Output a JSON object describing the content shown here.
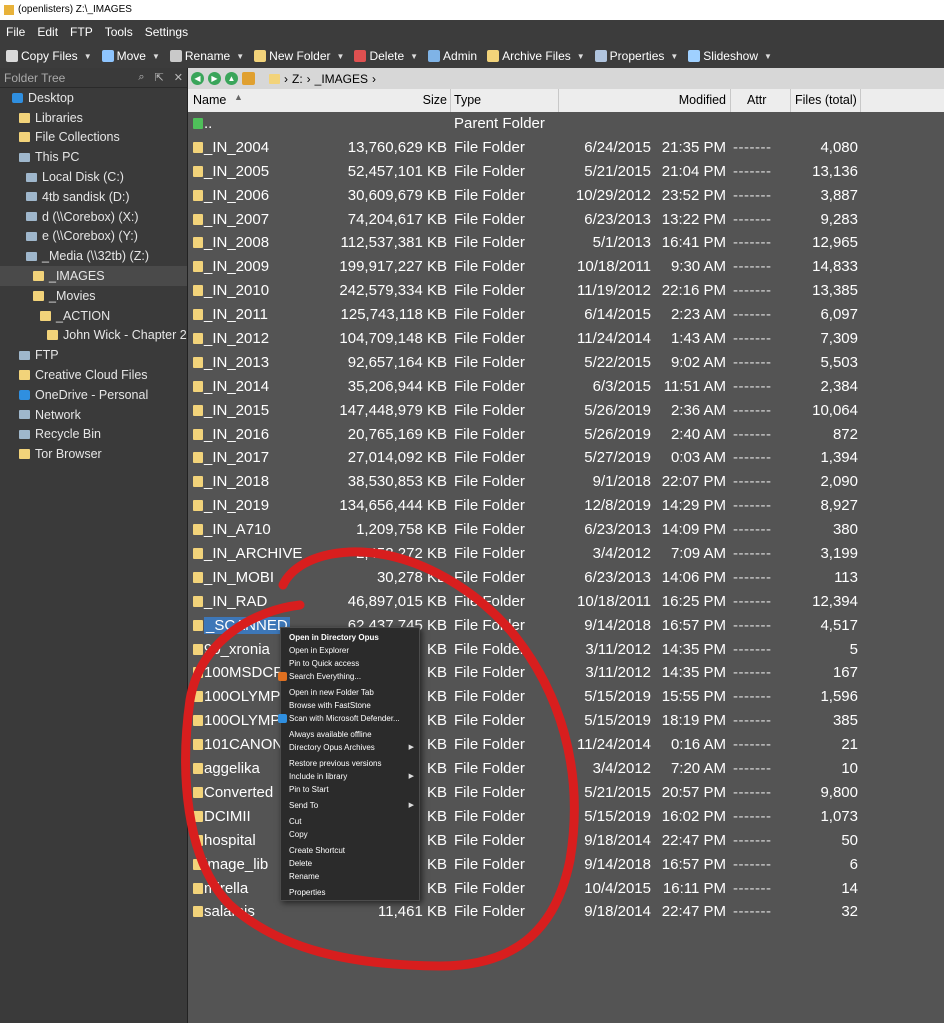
{
  "window": {
    "title": "(openlisters) Z:\\_IMAGES"
  },
  "menu": [
    "File",
    "Edit",
    "FTP",
    "Tools",
    "Settings"
  ],
  "toolbar": [
    {
      "label": "Copy Files",
      "dropdown": true,
      "icon": "copy-icon",
      "color": "#d9d9d9"
    },
    {
      "label": "Move",
      "dropdown": true,
      "icon": "move-icon",
      "color": "#8ec5ff"
    },
    {
      "label": "Rename",
      "dropdown": true,
      "icon": "rename-icon",
      "color": "#c9c9c9"
    },
    {
      "label": "New Folder",
      "dropdown": true,
      "icon": "new-folder-icon",
      "color": "#f2d37a"
    },
    {
      "label": "Delete",
      "dropdown": true,
      "icon": "delete-icon",
      "color": "#e05050"
    },
    {
      "label": "Admin",
      "dropdown": false,
      "icon": "admin-icon",
      "color": "#7fb3e6"
    },
    {
      "label": "Archive Files",
      "dropdown": true,
      "icon": "archive-icon",
      "color": "#f2d37a"
    },
    {
      "label": "Properties",
      "dropdown": true,
      "icon": "properties-icon",
      "color": "#b0c4de"
    },
    {
      "label": "Slideshow",
      "dropdown": true,
      "icon": "slideshow-icon",
      "color": "#9fd0ff"
    }
  ],
  "folder_tree": {
    "title": "Folder Tree",
    "items": [
      {
        "label": "Desktop",
        "indent": 0,
        "icon": "desktop-icon"
      },
      {
        "label": "Libraries",
        "indent": 1,
        "icon": "libraries-icon"
      },
      {
        "label": "File Collections",
        "indent": 1,
        "icon": "collections-icon"
      },
      {
        "label": "This PC",
        "indent": 1,
        "icon": "pc-icon"
      },
      {
        "label": "Local Disk (C:)",
        "indent": 2,
        "icon": "drive-icon"
      },
      {
        "label": "4tb sandisk (D:)",
        "indent": 2,
        "icon": "drive-icon"
      },
      {
        "label": "d (\\\\Corebox) (X:)",
        "indent": 2,
        "icon": "network-drive-icon"
      },
      {
        "label": "e (\\\\Corebox) (Y:)",
        "indent": 2,
        "icon": "network-drive-icon"
      },
      {
        "label": "_Media (\\\\32tb) (Z:)",
        "indent": 2,
        "icon": "network-drive-icon"
      },
      {
        "label": "_IMAGES",
        "indent": 3,
        "icon": "folder-icon",
        "selected": true
      },
      {
        "label": "_Movies",
        "indent": 3,
        "icon": "folder-icon"
      },
      {
        "label": "_ACTION",
        "indent": 4,
        "icon": "folder-icon"
      },
      {
        "label": "John Wick - Chapter 2",
        "indent": 5,
        "icon": "folder-icon"
      },
      {
        "label": "FTP",
        "indent": 1,
        "icon": "ftp-icon"
      },
      {
        "label": "Creative Cloud Files",
        "indent": 1,
        "icon": "cloud-icon"
      },
      {
        "label": "OneDrive - Personal",
        "indent": 1,
        "icon": "onedrive-icon"
      },
      {
        "label": "Network",
        "indent": 1,
        "icon": "network-icon"
      },
      {
        "label": "Recycle Bin",
        "indent": 1,
        "icon": "recycle-bin-icon"
      },
      {
        "label": "Tor Browser",
        "indent": 1,
        "icon": "folder-icon"
      }
    ]
  },
  "path": {
    "drive": "Z:",
    "folder": "_IMAGES",
    "sep": "›"
  },
  "columns": {
    "name": "Name",
    "size": "Size",
    "type": "Type",
    "modified": "Modified",
    "attr": "Attr",
    "files": "Files (total)"
  },
  "parent_row": {
    "name": "..",
    "type": "Parent Folder"
  },
  "files": [
    {
      "name": "_IN_2004",
      "size": "13,760,629 KB",
      "type": "File Folder",
      "date": "6/24/2015",
      "time": "21:35 PM",
      "attr": "-------",
      "files": "4,080"
    },
    {
      "name": "_IN_2005",
      "size": "52,457,101 KB",
      "type": "File Folder",
      "date": "5/21/2015",
      "time": "21:04 PM",
      "attr": "-------",
      "files": "13,136"
    },
    {
      "name": "_IN_2006",
      "size": "30,609,679 KB",
      "type": "File Folder",
      "date": "10/29/2012",
      "time": "23:52 PM",
      "attr": "-------",
      "files": "3,887"
    },
    {
      "name": "_IN_2007",
      "size": "74,204,617 KB",
      "type": "File Folder",
      "date": "6/23/2013",
      "time": "13:22 PM",
      "attr": "-------",
      "files": "9,283"
    },
    {
      "name": "_IN_2008",
      "size": "112,537,381 KB",
      "type": "File Folder",
      "date": "5/1/2013",
      "time": "16:41 PM",
      "attr": "-------",
      "files": "12,965"
    },
    {
      "name": "_IN_2009",
      "size": "199,917,227 KB",
      "type": "File Folder",
      "date": "10/18/2011",
      "time": "9:30 AM",
      "attr": "-------",
      "files": "14,833"
    },
    {
      "name": "_IN_2010",
      "size": "242,579,334 KB",
      "type": "File Folder",
      "date": "11/19/2012",
      "time": "22:16 PM",
      "attr": "-------",
      "files": "13,385"
    },
    {
      "name": "_IN_2011",
      "size": "125,743,118 KB",
      "type": "File Folder",
      "date": "6/14/2015",
      "time": "2:23 AM",
      "attr": "-------",
      "files": "6,097"
    },
    {
      "name": "_IN_2012",
      "size": "104,709,148 KB",
      "type": "File Folder",
      "date": "11/24/2014",
      "time": "1:43 AM",
      "attr": "-------",
      "files": "7,309"
    },
    {
      "name": "_IN_2013",
      "size": "92,657,164 KB",
      "type": "File Folder",
      "date": "5/22/2015",
      "time": "9:02 AM",
      "attr": "-------",
      "files": "5,503"
    },
    {
      "name": "_IN_2014",
      "size": "35,206,944 KB",
      "type": "File Folder",
      "date": "6/3/2015",
      "time": "11:51 AM",
      "attr": "-------",
      "files": "2,384"
    },
    {
      "name": "_IN_2015",
      "size": "147,448,979 KB",
      "type": "File Folder",
      "date": "5/26/2019",
      "time": "2:36 AM",
      "attr": "-------",
      "files": "10,064"
    },
    {
      "name": "_IN_2016",
      "size": "20,765,169 KB",
      "type": "File Folder",
      "date": "5/26/2019",
      "time": "2:40 AM",
      "attr": "-------",
      "files": "872"
    },
    {
      "name": "_IN_2017",
      "size": "27,014,092 KB",
      "type": "File Folder",
      "date": "5/27/2019",
      "time": "0:03 AM",
      "attr": "-------",
      "files": "1,394"
    },
    {
      "name": "_IN_2018",
      "size": "38,530,853 KB",
      "type": "File Folder",
      "date": "9/1/2018",
      "time": "22:07 PM",
      "attr": "-------",
      "files": "2,090"
    },
    {
      "name": "_IN_2019",
      "size": "134,656,444 KB",
      "type": "File Folder",
      "date": "12/8/2019",
      "time": "14:29 PM",
      "attr": "-------",
      "files": "8,927"
    },
    {
      "name": "_IN_A710",
      "size": "1,209,758 KB",
      "type": "File Folder",
      "date": "6/23/2013",
      "time": "14:09 PM",
      "attr": "-------",
      "files": "380"
    },
    {
      "name": "_IN_ARCHIVE",
      "size": "2,458,272 KB",
      "type": "File Folder",
      "date": "3/4/2012",
      "time": "7:09 AM",
      "attr": "-------",
      "files": "3,199"
    },
    {
      "name": "_IN_MOBI",
      "size": "30,278 KB",
      "type": "File Folder",
      "date": "6/23/2013",
      "time": "14:06 PM",
      "attr": "-------",
      "files": "113"
    },
    {
      "name": "_IN_RAD",
      "size": "46,897,015 KB",
      "type": "File Folder",
      "date": "10/18/2011",
      "time": "16:25 PM",
      "attr": "-------",
      "files": "12,394"
    },
    {
      "name": "_SCANNED",
      "size": "62,437,745 KB",
      "type": "File Folder",
      "date": "9/14/2018",
      "time": "16:57 PM",
      "attr": "-------",
      "files": "4,517",
      "highlighted": true
    },
    {
      "name": "90_xronia",
      "size": "KB",
      "type": "File Folder",
      "date": "3/11/2012",
      "time": "14:35 PM",
      "attr": "-------",
      "files": "5"
    },
    {
      "name": "100MSDCF",
      "size": "KB",
      "type": "File Folder",
      "date": "3/11/2012",
      "time": "14:35 PM",
      "attr": "-------",
      "files": "167"
    },
    {
      "name": "100OLYMP",
      "size": "KB",
      "type": "File Folder",
      "date": "5/15/2019",
      "time": "15:55 PM",
      "attr": "-------",
      "files": "1,596"
    },
    {
      "name": "100OLYMP",
      "size": "KB",
      "type": "File Folder",
      "date": "5/15/2019",
      "time": "18:19 PM",
      "attr": "-------",
      "files": "385"
    },
    {
      "name": "101CANON",
      "size": "KB",
      "type": "File Folder",
      "date": "11/24/2014",
      "time": "0:16 AM",
      "attr": "-------",
      "files": "21"
    },
    {
      "name": "aggelika",
      "size": "KB",
      "type": "File Folder",
      "date": "3/4/2012",
      "time": "7:20 AM",
      "attr": "-------",
      "files": "10"
    },
    {
      "name": "Converted",
      "size": "KB",
      "type": "File Folder",
      "date": "5/21/2015",
      "time": "20:57 PM",
      "attr": "-------",
      "files": "9,800"
    },
    {
      "name": "DCIMII",
      "size": "KB",
      "type": "File Folder",
      "date": "5/15/2019",
      "time": "16:02 PM",
      "attr": "-------",
      "files": "1,073"
    },
    {
      "name": "hospital",
      "size": "KB",
      "type": "File Folder",
      "date": "9/18/2014",
      "time": "22:47 PM",
      "attr": "-------",
      "files": "50"
    },
    {
      "name": "image_lib",
      "size": "KB",
      "type": "File Folder",
      "date": "9/14/2018",
      "time": "16:57 PM",
      "attr": "-------",
      "files": "6"
    },
    {
      "name": "mirella",
      "size": "KB",
      "type": "File Folder",
      "date": "10/4/2015",
      "time": "16:11 PM",
      "attr": "-------",
      "files": "14"
    },
    {
      "name": "salamis",
      "size": "11,461 KB",
      "type": "File Folder",
      "date": "9/18/2014",
      "time": "22:47 PM",
      "attr": "-------",
      "files": "32"
    }
  ],
  "context_menu": {
    "groups": [
      [
        {
          "label": "Open in Directory Opus",
          "bold": true
        },
        {
          "label": "Open in Explorer"
        },
        {
          "label": "Pin to Quick access"
        },
        {
          "label": "Search Everything...",
          "icon": "search-icon",
          "icon_color": "#e07020"
        }
      ],
      [
        {
          "label": "Open in new Folder Tab"
        },
        {
          "label": "Browse with FastStone"
        },
        {
          "label": "Scan with Microsoft Defender...",
          "icon": "defender-shield-icon",
          "icon_color": "#2f8fe0"
        }
      ],
      [
        {
          "label": "Always available offline"
        },
        {
          "label": "Directory Opus Archives",
          "submenu": true
        }
      ],
      [
        {
          "label": "Restore previous versions"
        },
        {
          "label": "Include in library",
          "submenu": true
        },
        {
          "label": "Pin to Start"
        }
      ],
      [
        {
          "label": "Send To",
          "submenu": true
        }
      ],
      [
        {
          "label": "Cut"
        },
        {
          "label": "Copy"
        }
      ],
      [
        {
          "label": "Create Shortcut"
        },
        {
          "label": "Delete"
        },
        {
          "label": "Rename"
        }
      ],
      [
        {
          "label": "Properties"
        }
      ]
    ]
  },
  "colors": {
    "annotation_circle": "#d81e1e",
    "selection": "#3d77b8",
    "folder": "#f2d37a"
  }
}
